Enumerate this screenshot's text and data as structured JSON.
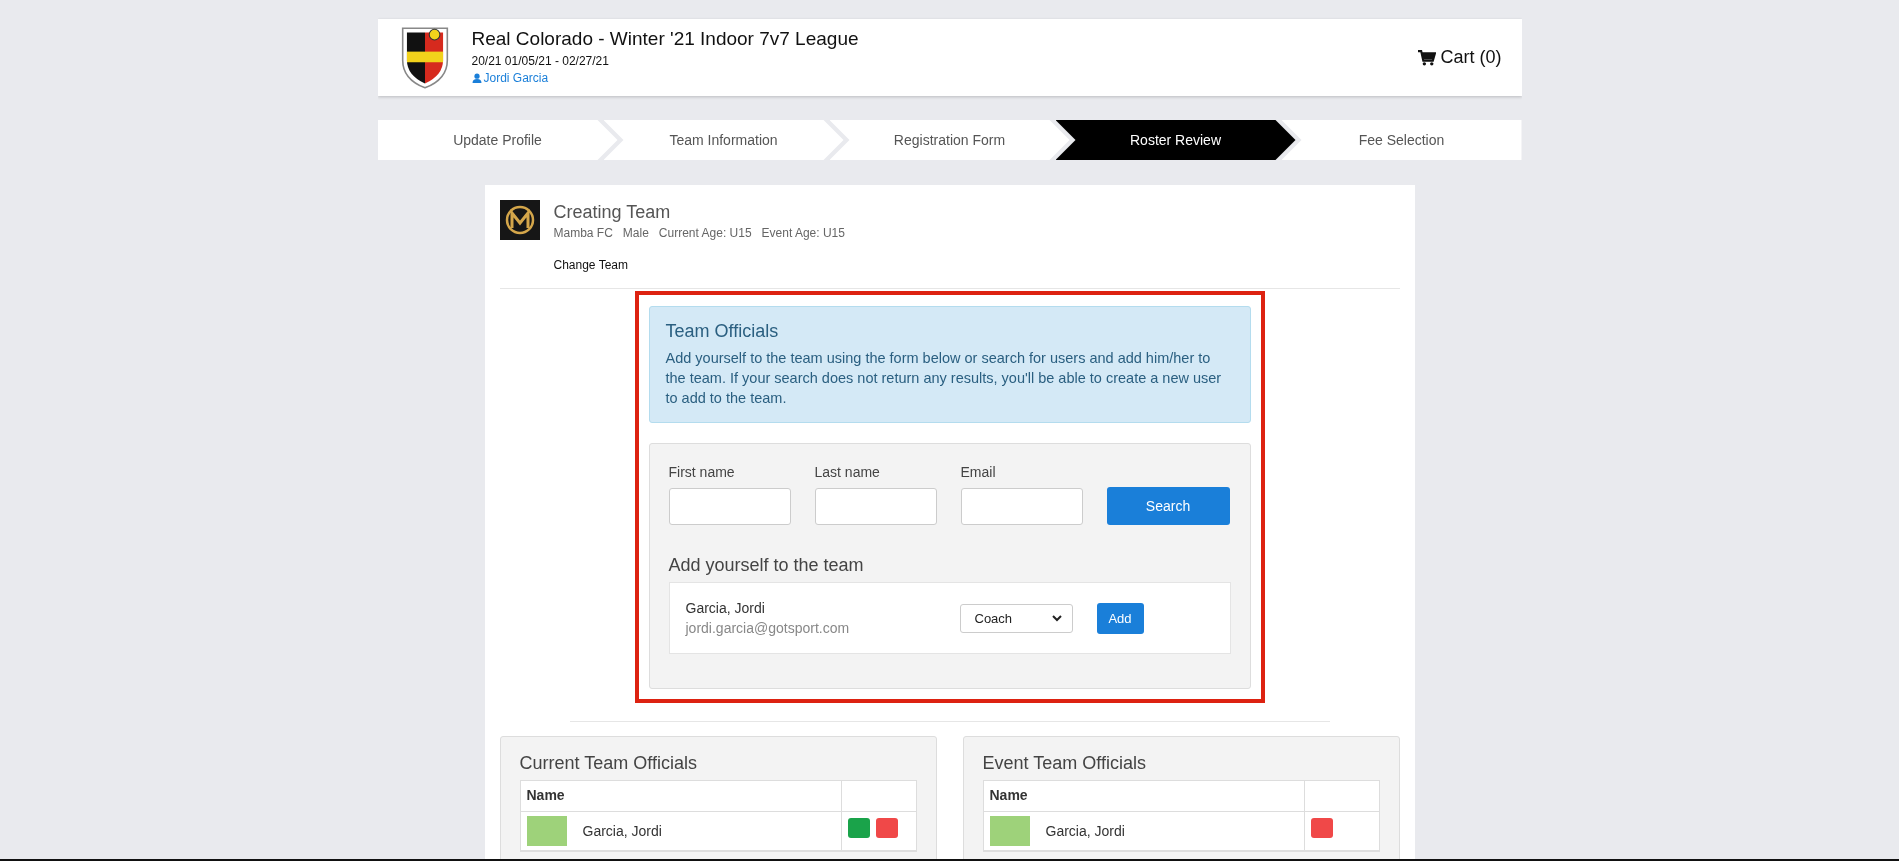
{
  "header": {
    "title": "Real Colorado - Winter '21 Indoor 7v7 League",
    "dates": "20/21 01/05/21 - 02/27/21",
    "user": "Jordi Garcia",
    "cart": "Cart (0)"
  },
  "steps": [
    {
      "label": "Update Profile",
      "selected": false
    },
    {
      "label": "Team Information",
      "selected": false
    },
    {
      "label": "Registration Form",
      "selected": false
    },
    {
      "label": "Roster Review",
      "selected": true
    },
    {
      "label": "Fee Selection",
      "selected": false
    }
  ],
  "team": {
    "title": "Creating Team",
    "details": [
      "Mamba FC",
      "Male",
      "Current Age: U15",
      "Event Age: U15"
    ],
    "change_link": "Change Team"
  },
  "officials": {
    "title": "Team Officials",
    "description": "Add yourself to the team using the form below or search for users and add him/her to the team. If your search does not return any results, you'll be able to create a new user to add to the team.",
    "fields": [
      {
        "label": "First name"
      },
      {
        "label": "Last name"
      },
      {
        "label": "Email"
      }
    ],
    "search_button": "Search",
    "add_yourself": {
      "title": "Add yourself to the team",
      "name": "Garcia, Jordi",
      "email": "jordi.garcia@gotsport.com",
      "role": "Coach",
      "add_button": "Add"
    }
  },
  "panels": [
    {
      "title": "Current Team Officials",
      "column": "Name",
      "rows": [
        {
          "name": "Garcia, Jordi",
          "actions": [
            {
              "kind": "add"
            },
            {
              "kind": "remove"
            }
          ]
        }
      ]
    },
    {
      "title": "Event Team Officials",
      "column": "Name",
      "rows": [
        {
          "name": "Garcia, Jordi",
          "actions": [
            {
              "kind": "remove"
            }
          ]
        }
      ]
    }
  ]
}
